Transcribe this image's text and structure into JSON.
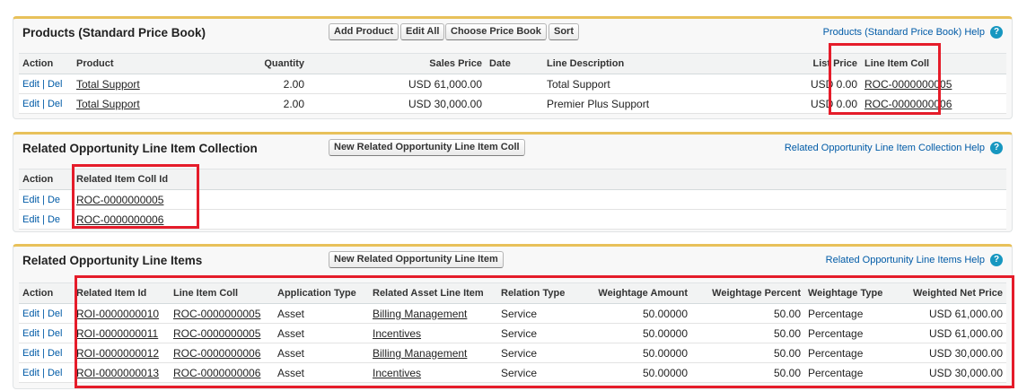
{
  "products": {
    "title": "Products (Standard Price Book)",
    "buttons": [
      "Add Product",
      "Edit All",
      "Choose Price Book",
      "Sort"
    ],
    "help": "Products (Standard Price Book) Help",
    "columns": [
      "Action",
      "Product",
      "Quantity",
      "Sales Price",
      "Date",
      "Line Description",
      "List Price",
      "Line Item Coll"
    ],
    "rows": [
      {
        "edit": "Edit",
        "del": "Del",
        "product": "Total Support",
        "quantity": "2.00",
        "sales_price": "USD 61,000.00",
        "date": "",
        "line_description": "Total Support",
        "list_price": "USD 0.00",
        "line_item_coll": "ROC-0000000005"
      },
      {
        "edit": "Edit",
        "del": "Del",
        "product": "Total Support",
        "quantity": "2.00",
        "sales_price": "USD 30,000.00",
        "date": "",
        "line_description": "Premier Plus Support",
        "list_price": "USD 0.00",
        "line_item_coll": "ROC-0000000006"
      }
    ]
  },
  "collection": {
    "title": "Related Opportunity Line Item Collection",
    "button": "New Related Opportunity Line Item Coll",
    "help": "Related Opportunity Line Item Collection Help",
    "columns": [
      "Action",
      "Related Item Coll Id"
    ],
    "rows": [
      {
        "edit": "Edit",
        "del": "De",
        "id": "ROC-0000000005"
      },
      {
        "edit": "Edit",
        "del": "De",
        "id": "ROC-0000000006"
      }
    ]
  },
  "line_items": {
    "title": "Related Opportunity Line Items",
    "button": "New Related Opportunity Line Item",
    "help": "Related Opportunity Line Items Help",
    "columns": [
      "Action",
      "Related Item Id",
      "Line Item Coll",
      "Application Type",
      "Related Asset Line Item",
      "Relation Type",
      "Weightage Amount",
      "Weightage Percent",
      "Weightage Type",
      "Weighted Net Price"
    ],
    "rows": [
      {
        "edit": "Edit",
        "del": "Del",
        "id": "ROI-0000000010",
        "coll": "ROC-0000000005",
        "app_type": "Asset",
        "asset": "Billing Management",
        "relation": "Service",
        "amount": "50.00000",
        "percent": "50.00",
        "wtype": "Percentage",
        "net": "USD 61,000.00"
      },
      {
        "edit": "Edit",
        "del": "Del",
        "id": "ROI-0000000011",
        "coll": "ROC-0000000005",
        "app_type": "Asset",
        "asset": "Incentives",
        "relation": "Service",
        "amount": "50.00000",
        "percent": "50.00",
        "wtype": "Percentage",
        "net": "USD 61,000.00"
      },
      {
        "edit": "Edit",
        "del": "Del",
        "id": "ROI-0000000012",
        "coll": "ROC-0000000006",
        "app_type": "Asset",
        "asset": "Billing Management",
        "relation": "Service",
        "amount": "50.00000",
        "percent": "50.00",
        "wtype": "Percentage",
        "net": "USD 30,000.00"
      },
      {
        "edit": "Edit",
        "del": "Del",
        "id": "ROI-0000000013",
        "coll": "ROC-0000000006",
        "app_type": "Asset",
        "asset": "Incentives",
        "relation": "Service",
        "amount": "50.00000",
        "percent": "50.00",
        "wtype": "Percentage",
        "net": "USD 30,000.00"
      }
    ]
  },
  "help_icon": "?",
  "separator": "|",
  "colors": {
    "accent": "#e8c15a",
    "highlight": "#e51c2a",
    "link": "#015ba7"
  }
}
